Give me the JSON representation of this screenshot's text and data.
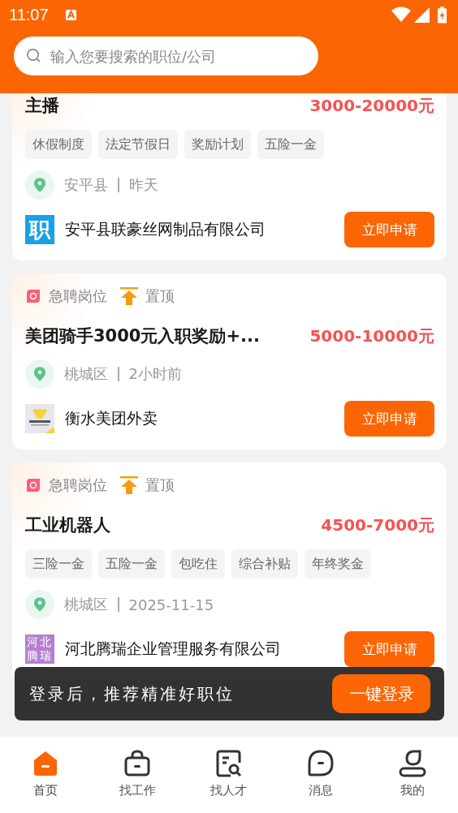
{
  "status_bar": {
    "time": "11:07"
  },
  "search": {
    "placeholder": "输入您要搜索的职位/公司"
  },
  "jobs": [
    {
      "title": "主播",
      "salary": "3000-20000元",
      "tags": [
        "休假制度",
        "法定节假日",
        "奖励计划",
        "五险一金"
      ],
      "location": "安平县",
      "time": "昨天",
      "company": "安平县联豪丝网制品有限公司",
      "logo": {
        "kind": "text",
        "text": "职",
        "color": "#18a0e8"
      },
      "apply": "立即申请"
    },
    {
      "urgent": true,
      "pinned": true,
      "urgent_label": "急聘岗位",
      "pinned_label": "置顶",
      "title": "美团骑手3000元入职奖励+...",
      "salary": "5000-10000元",
      "location": "桃城区",
      "time": "2小时前",
      "company": "衡水美团外卖",
      "apply": "立即申请"
    },
    {
      "urgent": true,
      "pinned": true,
      "urgent_label": "急聘岗位",
      "pinned_label": "置顶",
      "title": "工业机器人",
      "salary": "4500-7000元",
      "tags": [
        "三险一金",
        "五险一金",
        "包吃住",
        "综合补贴",
        "年终奖金"
      ],
      "location": "桃城区",
      "time": "2025-11-15",
      "company": "河北腾瑞企业管理服务有限公司",
      "logo": {
        "kind": "grid",
        "text": "河北腾瑞",
        "color": "#b57fd0"
      },
      "apply": "立即申请"
    }
  ],
  "login_prompt": {
    "text": "登录后，推荐精准好职位",
    "button": "一键登录"
  },
  "tabs": [
    {
      "label": "首页",
      "selected": true
    },
    {
      "label": "找工作",
      "selected": false
    },
    {
      "label": "找人才",
      "selected": false
    },
    {
      "label": "消息",
      "selected": false
    },
    {
      "label": "我的",
      "selected": false
    }
  ]
}
